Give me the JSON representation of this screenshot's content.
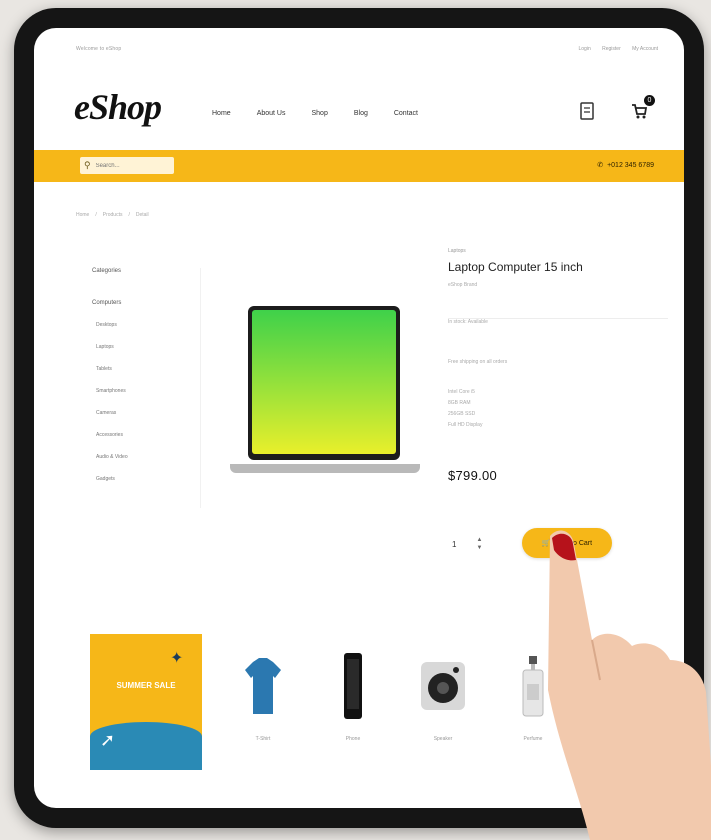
{
  "header": {
    "topstrip_left": "Welcome to eShop",
    "topstrip_links": [
      "Login",
      "Register",
      "My Account"
    ],
    "logo": "eShop",
    "nav": [
      "Home",
      "About Us",
      "Shop",
      "Blog",
      "Contact"
    ],
    "cart_count": "0"
  },
  "search": {
    "placeholder": "Search..."
  },
  "phone": "+012 345 6789",
  "breadcrumb": [
    "Home",
    "Products",
    "Detail"
  ],
  "sidebar": {
    "group1": "Categories",
    "group2": "Computers",
    "items": [
      "Desktops",
      "Laptops",
      "Tablets",
      "Smartphones",
      "Cameras",
      "Accessories",
      "Audio & Video",
      "Gadgets"
    ]
  },
  "product": {
    "category": "Laptops",
    "name": "Laptop Computer 15 inch",
    "brand": "eShop Brand",
    "stock": "In stock: Available",
    "shipping": "Free shipping on all orders",
    "specs": [
      "Intel Core i5",
      "8GB RAM",
      "256GB SSD",
      "Full HD Display"
    ],
    "price": "$799.00",
    "quantity": "1",
    "add_to_cart": "Add to Cart"
  },
  "promo": {
    "title": "SUMMER SALE"
  },
  "related_products": [
    {
      "label": "T-Shirt",
      "icon": "tshirt-icon"
    },
    {
      "label": "Phone",
      "icon": "phone-icon"
    },
    {
      "label": "Speaker",
      "icon": "speaker-icon"
    },
    {
      "label": "Perfume",
      "icon": "perfume-icon"
    }
  ],
  "colors": {
    "accent": "#f6b718",
    "promo_blue": "#2a8ab5"
  }
}
